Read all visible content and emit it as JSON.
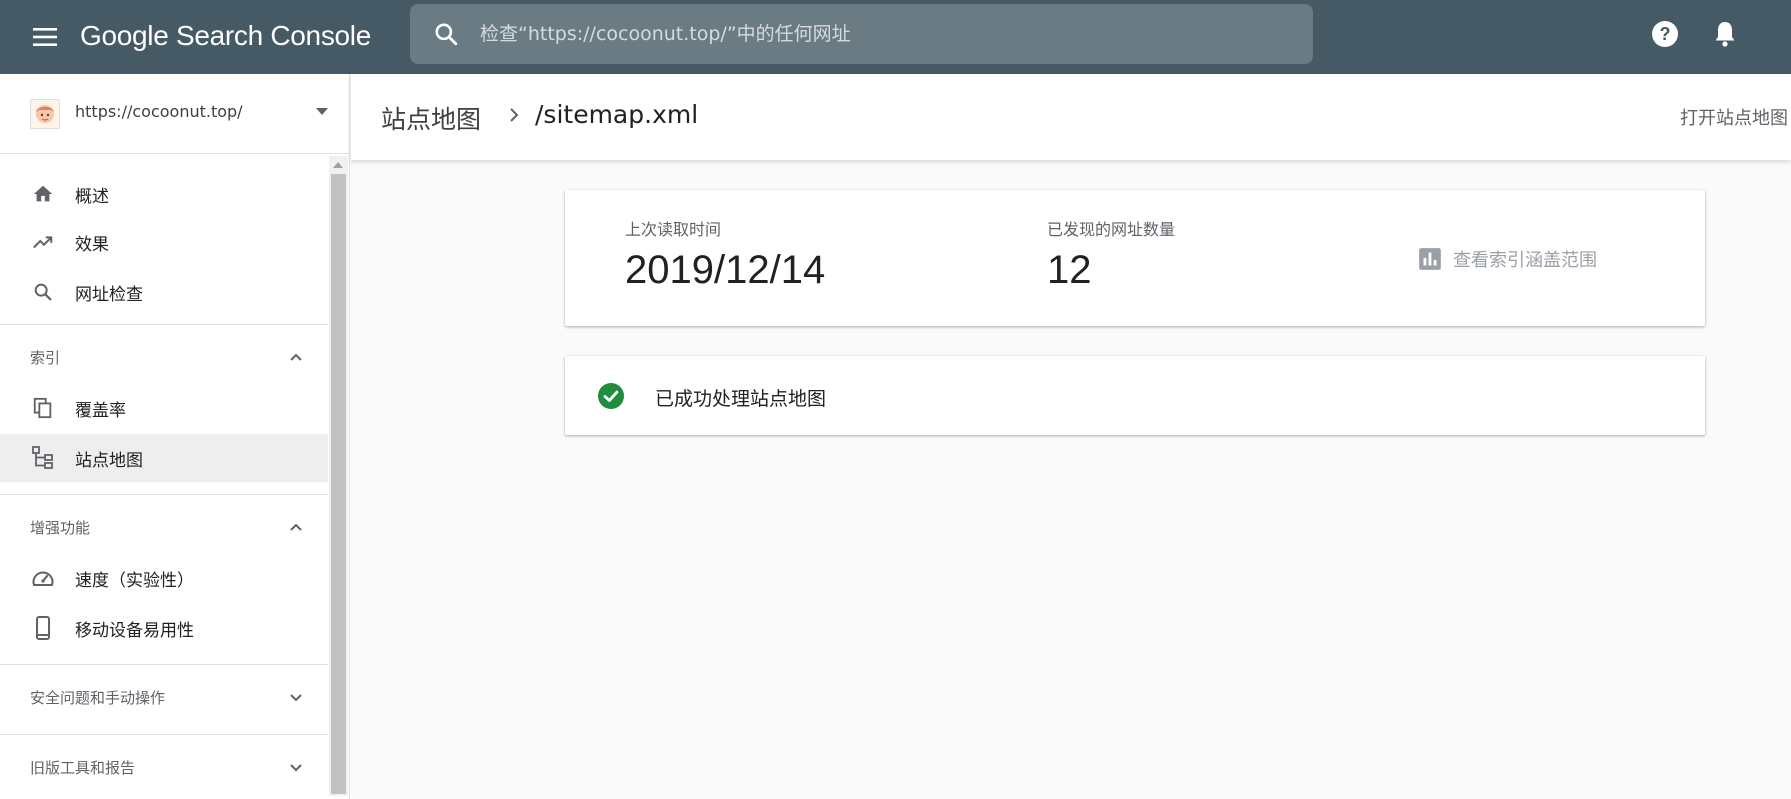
{
  "app": {
    "title": "Google Search Console"
  },
  "search": {
    "placeholder": "检查“https://cocoonut.top/”中的任何网址"
  },
  "property": {
    "url": "https://cocoonut.top/"
  },
  "sidebar": {
    "items": [
      {
        "label": "概述",
        "icon": "home-icon"
      },
      {
        "label": "效果",
        "icon": "trending-up-icon"
      },
      {
        "label": "网址检查",
        "icon": "search-icon"
      }
    ],
    "sections": [
      {
        "label": "索引",
        "expanded": true,
        "items": [
          {
            "label": "覆盖率",
            "icon": "copy-icon"
          },
          {
            "label": "站点地图",
            "icon": "sitemap-icon",
            "active": true
          }
        ]
      },
      {
        "label": "增强功能",
        "expanded": true,
        "items": [
          {
            "label": "速度（实验性）",
            "icon": "speedometer-icon"
          },
          {
            "label": "移动设备易用性",
            "icon": "smartphone-icon"
          }
        ]
      },
      {
        "label": "安全问题和手动操作",
        "expanded": false
      },
      {
        "label": "旧版工具和报告",
        "expanded": false
      }
    ]
  },
  "header": {
    "breadcrumb_root": "站点地图",
    "breadcrumb_current": "/sitemap.xml",
    "open_link": "打开站点地图"
  },
  "stats": {
    "last_read_label": "上次读取时间",
    "last_read_value": "2019/12/14",
    "discovered_label": "已发现的网址数量",
    "discovered_value": "12",
    "coverage_link": "查看索引涵盖范围"
  },
  "status": {
    "text": "已成功处理站点地图"
  },
  "colors": {
    "topbar": "#455a64",
    "success": "#1e8e3e",
    "active_row": "#eeeeee"
  }
}
